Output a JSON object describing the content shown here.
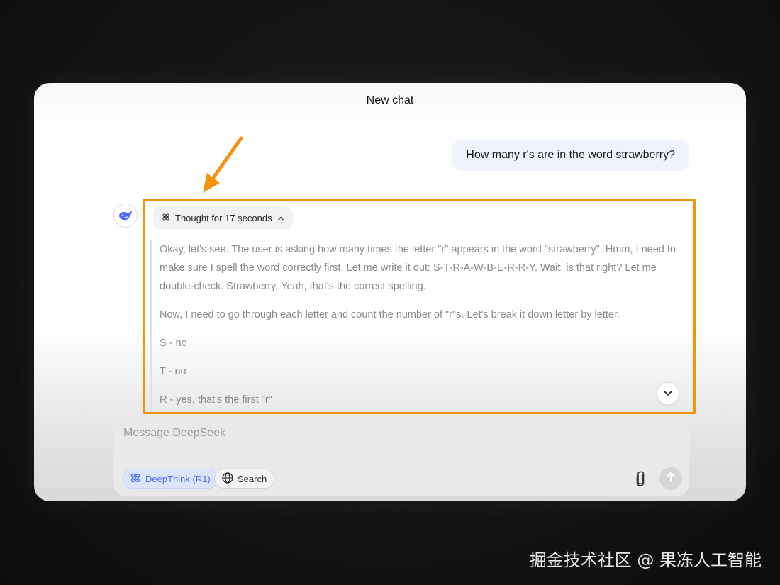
{
  "window": {
    "title": "New chat"
  },
  "user_message": {
    "text": "How many r's are in the word strawberry?"
  },
  "assistant": {
    "avatar_icon": "deepseek-whale-icon",
    "thought_toggle_label": "Thought for 17 seconds",
    "thought_paragraphs": [
      "Okay, let's see. The user is asking how many times the letter \"r\" appears in the word \"strawberry\". Hmm, I need to make sure I spell the word correctly first. Let me write it out: S-T-R-A-W-B-E-R-R-Y. Wait, is that right? Let me double-check. Strawberry. Yeah, that's the correct spelling.",
      "Now, I need to go through each letter and count the number of \"r\"s. Let's break it down letter by letter.",
      "S - no",
      "T - no",
      "R - yes, that's the first \"r\""
    ]
  },
  "composer": {
    "placeholder": "Message DeepSeek",
    "deepthink_label": "DeepThink (R1)",
    "search_label": "Search"
  },
  "annotation": {
    "highlight_color": "#f5930f"
  },
  "watermark": {
    "text": "掘金技术社区 @ 果冻人工智能"
  },
  "colors": {
    "accent": "#4d6bfe",
    "user_bubble": "#eef3fc"
  }
}
